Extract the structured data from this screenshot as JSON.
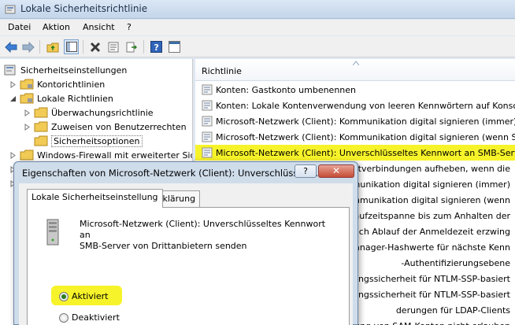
{
  "window": {
    "title": "Lokale Sicherheitsrichtlinie"
  },
  "menu": [
    "Datei",
    "Aktion",
    "Ansicht",
    "?"
  ],
  "toolbar": {
    "icons": [
      "back-arrow-icon",
      "forward-arrow-icon",
      "up-folder-icon",
      "show-hide-tree-icon",
      "delete-icon",
      "properties-icon",
      "export-list-icon",
      "help-icon",
      "console-icon"
    ]
  },
  "tree": {
    "root": "Sicherheitseinstellungen",
    "items": [
      {
        "label": "Kontorichtlinien",
        "level": 1,
        "expander": "collapsed"
      },
      {
        "label": "Lokale Richtlinien",
        "level": 1,
        "expander": "expanded"
      },
      {
        "label": "Überwachungsrichtlinie",
        "level": 2,
        "expander": "collapsed"
      },
      {
        "label": "Zuweisen von Benutzerrechten",
        "level": 2,
        "expander": "collapsed"
      },
      {
        "label": "Sicherheitsoptionen",
        "level": 2,
        "expander": "none",
        "selected": true
      },
      {
        "label": "Windows-Firewall mit erweiterter Sich",
        "level": 1,
        "expander": "collapsed"
      }
    ]
  },
  "list": {
    "column_header": "Richtlinie",
    "rows": [
      "Konten: Gastkonto umbenennen",
      "Konten: Lokale Kontenverwendung von leeren Kennwörtern auf Konso",
      "Microsoft-Netzwerk (Client): Kommunikation digital signieren (immer)",
      "Microsoft-Netzwerk (Client): Kommunikation digital signieren (wenn S",
      "Microsoft-Netzwerk (Client): Unverschlüsseltes Kennwort an SMB-Serv",
      "Microsoft-Netzwerk (Server): Clientverbindungen aufheben, wenn die",
      "icrosoft-Netzwerk (Server): Kommunikation digital signieren (immer)",
      "icrosoft-Netzwerk (Server): Kommunikation digital signieren (wenn",
      "icrosoft-Netzwerk (Server): Leerlaufzeitspanne bis zum Anhalten der",
      "etzwerksicherheit: Abmeldung nach Ablauf der Anmeldezeit erzwing",
      "etzwerksicherheit: Keine LAN Manager-Hashwerte für nächste Kenn",
      "etzwerksicherheit: LAN Manager-Authentifizierungsebene",
      "etzwerksicherheit: Minimale Sitzungssicherheit für NTLM-SSP-basiert",
      "etzwerksicherheit: Minimale Sitzungssicherheit für NTLM-SSP-basiert",
      "etzwerksicherheit: Signaturanforderungen für LDAP-Clients",
      "etzwerkzugriff: Anonyme Aufzählung von SAM-Konten nicht erlauben"
    ],
    "visible_tails": [
      "",
      "",
      "",
      "",
      "",
      "Clientverbindungen aufheben, wenn die",
      "ommunikation digital signieren (immer)",
      "ommunikation digital signieren (wenn",
      "aufzeitspanne bis zum Anhalten der",
      "ch Ablauf der Anmeldezeit erzwing",
      "anager-Hashwerte für nächste Kenn",
      "-Authentifizierungsebene",
      "ungssicherheit für NTLM-SSP-basiert",
      "ungssicherheit für NTLM-SSP-basiert",
      "derungen für LDAP-Clients",
      "ung von SAM-Konten nicht erlauben"
    ],
    "highlighted_index": 4
  },
  "dialog": {
    "title": "Eigenschaften von Microsoft-Netzwerk (Client): Unverschlüsselt...",
    "help_label": "?",
    "close_label": "✕",
    "tabs": [
      "Lokale Sicherheitseinstellung",
      "Erklärung"
    ],
    "active_tab": 0,
    "description_line1": "Microsoft-Netzwerk (Client): Unverschlüsseltes Kennwort an",
    "description_line2": "SMB-Server von Drittanbietern senden",
    "options": [
      {
        "label": "Aktiviert",
        "checked": true
      },
      {
        "label": "Deaktiviert",
        "checked": false
      }
    ]
  },
  "colors": {
    "highlight": "#f7f32a",
    "title_bg": "#c4d5ea",
    "accent": "#3a6ea5"
  }
}
